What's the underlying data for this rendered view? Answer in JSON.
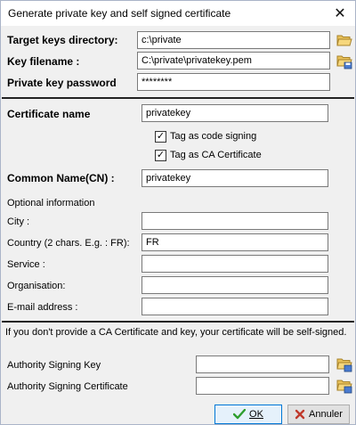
{
  "window": {
    "title": "Generate private key and self signed certificate",
    "close_glyph": "✕"
  },
  "keys": {
    "target_dir_label": "Target keys directory:",
    "target_dir_value": "c:\\private",
    "key_filename_label": "Key filename :",
    "key_filename_value": "C:\\private\\privatekey.pem",
    "password_label": "Private key password",
    "password_value": "********"
  },
  "certificate": {
    "name_label": "Certificate name",
    "name_value": "privatekey",
    "code_signing_label": "Tag as code signing",
    "code_signing_checked": true,
    "ca_cert_label": "Tag as CA Certificate",
    "ca_cert_checked": true,
    "cn_label": "Common Name(CN) :",
    "cn_value": "privatekey"
  },
  "optional": {
    "heading": "Optional information",
    "city_label": "City :",
    "city_value": "",
    "country_label": "Country (2 chars. E.g. : FR):",
    "country_value": "FR",
    "service_label": "Service :",
    "service_value": "",
    "organisation_label": "Organisation:",
    "organisation_value": "",
    "email_label": "E-mail address :",
    "email_value": ""
  },
  "signing": {
    "note": "If you don't provide a CA Certificate and key, your certificate will be self-signed.",
    "authority_key_label": "Authority Signing Key",
    "authority_key_value": "",
    "authority_cert_label": "Authority Signing Certificate",
    "authority_cert_value": ""
  },
  "buttons": {
    "ok_label": "OK",
    "cancel_label": "Annuler"
  },
  "icons": {
    "folder": "folder-open-icon",
    "check": "green-check-icon",
    "cancel": "red-x-icon"
  },
  "colors": {
    "folder_yellow": "#e8c15a",
    "ok_green": "#2e9e2e",
    "cancel_red": "#c0392b",
    "window_bg": "#f0f0f0"
  }
}
